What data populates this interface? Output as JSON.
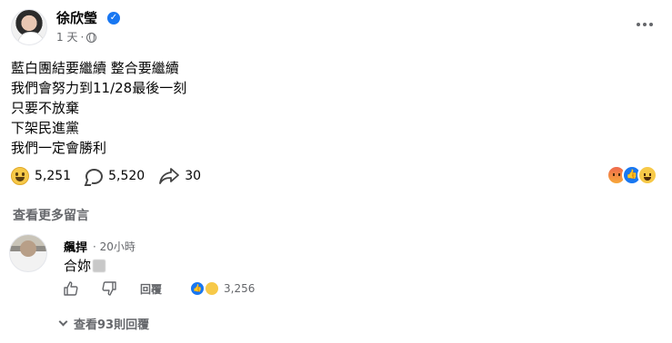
{
  "post": {
    "author": "徐欣瑩",
    "time": "1 天",
    "dot": "·",
    "lines": [
      "藍白團結要繼續 整合要繼續",
      "我們會努力到11/28最後一刻",
      "只要不放棄",
      "下架民進黨",
      "我們一定會勝利"
    ],
    "reactions_count": "5,251",
    "comments_count": "5,520",
    "shares_count": "30"
  },
  "comments": {
    "more_label": "查看更多留言",
    "items": [
      {
        "name": "飆捍",
        "time": "· 20小時",
        "text": "合妳",
        "reply_label": "回覆",
        "reaction_count": "3,256",
        "view_replies": "查看93則回覆"
      }
    ]
  },
  "icons": {
    "verified": "verified-badge-icon",
    "privacy": "globe-icon",
    "more": "more-options-icon",
    "react": "grin-emoji-icon",
    "comment": "comment-bubble-icon",
    "share": "share-arrow-icon",
    "like": "thumb-up-icon",
    "dislike": "thumb-down-icon"
  },
  "colors": {
    "accent": "#1877f2",
    "secondary_text": "#65676b"
  }
}
